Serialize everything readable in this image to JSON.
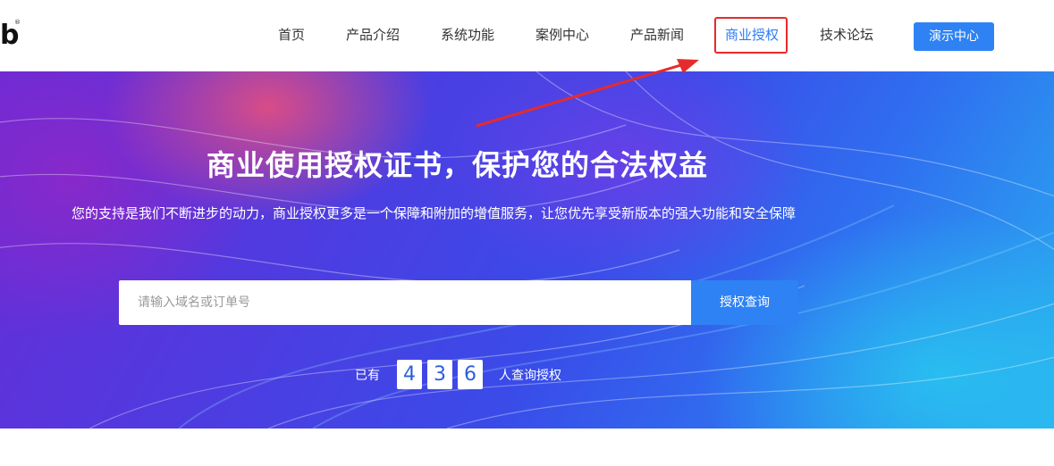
{
  "header": {
    "logo_text": "b",
    "logo_reg": "®",
    "nav": [
      {
        "label": "首页"
      },
      {
        "label": "产品介绍"
      },
      {
        "label": "系统功能"
      },
      {
        "label": "案例中心"
      },
      {
        "label": "产品新闻"
      },
      {
        "label": "商业授权",
        "active": true
      },
      {
        "label": "技术论坛"
      }
    ],
    "demo_button": "演示中心"
  },
  "hero": {
    "title": "商业使用授权证书，保护您的合法权益",
    "subtitle": "您的支持是我们不断进步的动力，商业授权更多是一个保障和附加的增值服务，让您优先享受新版本的强大功能和安全保障",
    "search": {
      "placeholder": "请输入域名或订单号",
      "value": "",
      "button": "授权查询"
    },
    "counter": {
      "prefix": "已有",
      "digits": [
        "4",
        "3",
        "6"
      ],
      "suffix": "人查询授权"
    }
  },
  "colors": {
    "accent": "#2e82f4",
    "highlight_box": "#e52b2b",
    "arrow": "#e52b2b"
  }
}
